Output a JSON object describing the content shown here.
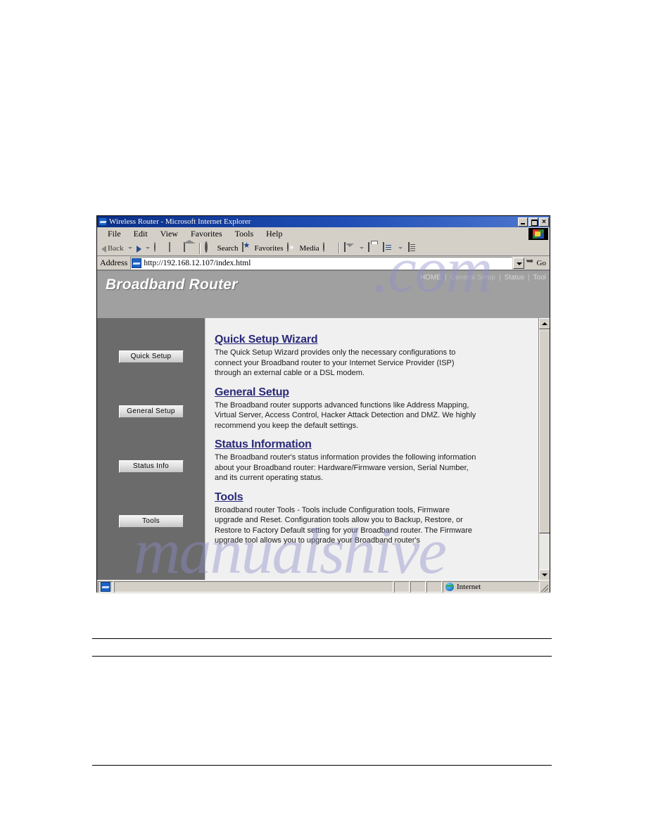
{
  "browser": {
    "window_title": "Wireless Router - Microsoft Internet Explorer",
    "title_icon": "ie-page-icon",
    "window_buttons": {
      "minimize": "minimize-icon",
      "maximize": "maximize-icon",
      "close": "×"
    },
    "menus": [
      {
        "label": "File",
        "mnemonic": "F"
      },
      {
        "label": "Edit",
        "mnemonic": "E"
      },
      {
        "label": "View",
        "mnemonic": "V"
      },
      {
        "label": "Favorites",
        "mnemonic": "a"
      },
      {
        "label": "Tools",
        "mnemonic": "T"
      },
      {
        "label": "Help",
        "mnemonic": "H"
      }
    ],
    "menu_labels": {
      "file": "File",
      "edit": "Edit",
      "view": "View",
      "favorites": "Favorites",
      "tools": "Tools",
      "help": "Help"
    },
    "toolbar": {
      "back_label": "Back",
      "forward_label": "",
      "search_label": "Search",
      "favorites_label": "Favorites",
      "media_label": "Media",
      "icons": [
        "back-arrow-icon",
        "forward-arrow-icon",
        "stop-icon",
        "refresh-icon",
        "home-icon",
        "search-icon",
        "favorites-star-icon",
        "media-icon",
        "history-icon",
        "mail-icon",
        "print-icon",
        "edit-icon",
        "discuss-icon"
      ]
    },
    "address": {
      "label": "Address",
      "url": "http://192.168.12.107/index.html",
      "placeholder": "",
      "go_label": "Go"
    },
    "statusbar": {
      "message": "",
      "zone": "Internet"
    }
  },
  "page": {
    "brand": "Broadband Router",
    "nav": [
      {
        "label": "HOME",
        "active": false
      },
      {
        "label": "General Setup",
        "active": true
      },
      {
        "label": "Status",
        "active": false
      },
      {
        "label": "Tool",
        "active": false
      }
    ],
    "nav_separator": "|",
    "sidebar": {
      "buttons": [
        {
          "label": "Quick Setup"
        },
        {
          "label": "General Setup"
        },
        {
          "label": "Status Info"
        },
        {
          "label": "Tools"
        }
      ]
    },
    "sections": [
      {
        "heading": "Quick Setup Wizard",
        "body": "The Quick Setup Wizard provides only the necessary configurations to connect your Broadband router to your Internet Service Provider (ISP) through an external cable or a DSL modem."
      },
      {
        "heading": "General Setup",
        "body": "The Broadband router supports advanced functions like Address Mapping, Virtual Server, Access Control, Hacker Attack Detection and DMZ. We highly recommend you keep the default settings."
      },
      {
        "heading": "Status Information",
        "body": "The Broadband router's status information provides the following information about your Broadband router: Hardware/Firmware version, Serial Number, and its current operating status."
      },
      {
        "heading": "Tools",
        "body": "Broadband router Tools - Tools include Configuration tools, Firmware upgrade and Reset. Configuration tools allow you to Backup, Restore, or Restore to Factory Default setting for your Broadband router. The Firmware upgrade tool allows you to upgrade your Broadband router's"
      }
    ],
    "colors": {
      "header_bg": "#a0a0a0",
      "sidebar_bg": "#6b6b6b",
      "content_bg": "#f0f0f0",
      "heading": "#2a2a7a",
      "brand_text": "#ffffff"
    }
  },
  "watermark": {
    "line1": "manualshive",
    "line2": ".com"
  }
}
